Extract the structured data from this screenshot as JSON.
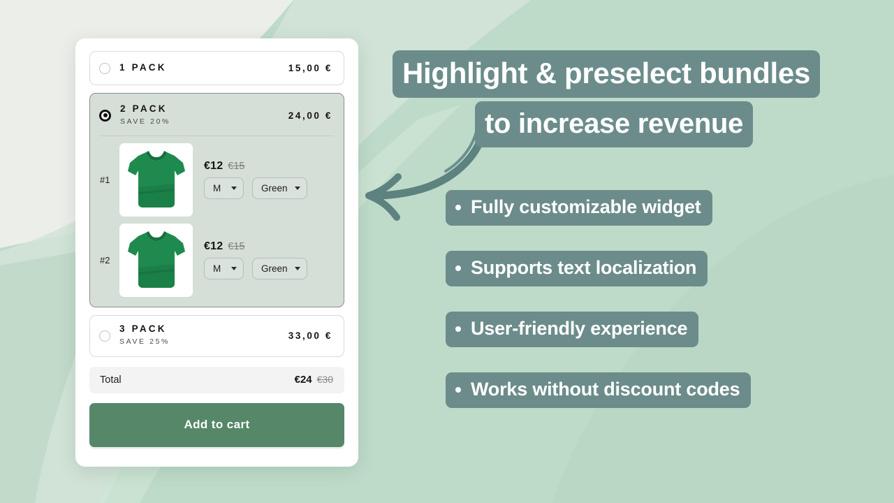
{
  "theme": {
    "background": "#bedbc9",
    "background_light": "#eceeea",
    "badge": "#6b8c8a",
    "cta": "#558768",
    "selected_panel": "#d5dfd8",
    "card": "#ffffff"
  },
  "widget": {
    "options": [
      {
        "id": "1-pack",
        "title": "1 PACK",
        "save": "",
        "price": "15,00 €",
        "selected": false
      },
      {
        "id": "2-pack",
        "title": "2 PACK",
        "save": "SAVE 20%",
        "price": "24,00 €",
        "selected": true
      },
      {
        "id": "3-pack",
        "title": "3 PACK",
        "save": "SAVE 25%",
        "price": "33,00 €",
        "selected": false
      }
    ],
    "bundle_items": [
      {
        "index": "#1",
        "price_now": "€12",
        "price_was": "€15",
        "size": "M",
        "color": "Green"
      },
      {
        "index": "#2",
        "price_now": "€12",
        "price_was": "€15",
        "size": "M",
        "color": "Green"
      }
    ],
    "total": {
      "label": "Total",
      "value": "€24",
      "compare_at": "€30"
    },
    "cta_label": "Add to cart"
  },
  "promo": {
    "headline_line1": "Highlight & preselect  bundles",
    "headline_line2": "to increase revenue",
    "bullets": [
      "Fully customizable widget",
      "Supports text localization",
      "User-friendly experience",
      "Works without discount codes"
    ]
  }
}
